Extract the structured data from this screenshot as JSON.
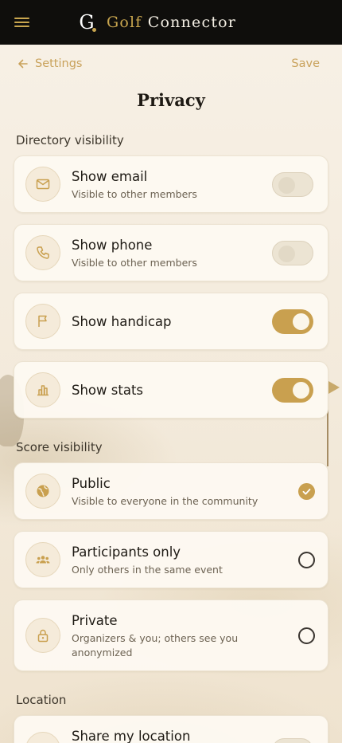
{
  "app": {
    "brand_logo": "G",
    "brand_first": "Golf",
    "brand_second": "Connector"
  },
  "nav": {
    "back_label": "Settings",
    "save_label": "Save"
  },
  "page": {
    "title": "Privacy"
  },
  "directory": {
    "label": "Directory visibility",
    "items": [
      {
        "title": "Show email",
        "subtitle": "Visible to other members",
        "icon": "mail-icon",
        "enabled": false
      },
      {
        "title": "Show phone",
        "subtitle": "Visible to other members",
        "icon": "phone-icon",
        "enabled": false
      },
      {
        "title": "Show handicap",
        "icon": "flag-icon",
        "enabled": true
      },
      {
        "title": "Show stats",
        "icon": "bar-chart-icon",
        "enabled": true
      }
    ]
  },
  "score": {
    "label": "Score visibility",
    "options": [
      {
        "title": "Public",
        "subtitle": "Visible to everyone in the community",
        "icon": "globe-icon",
        "selected": true
      },
      {
        "title": "Participants only",
        "subtitle": "Only others in the same event",
        "icon": "group-icon",
        "selected": false
      },
      {
        "title": "Private",
        "subtitle": "Organizers & you; others see you anonymized",
        "icon": "lock-icon",
        "selected": false
      }
    ]
  },
  "location": {
    "label": "Location",
    "items": [
      {
        "title": "Share my location",
        "enabled": false
      }
    ]
  },
  "colors": {
    "accent": "#c9a04f",
    "topbar": "#0f0e0c",
    "background": "#f6efe3"
  }
}
